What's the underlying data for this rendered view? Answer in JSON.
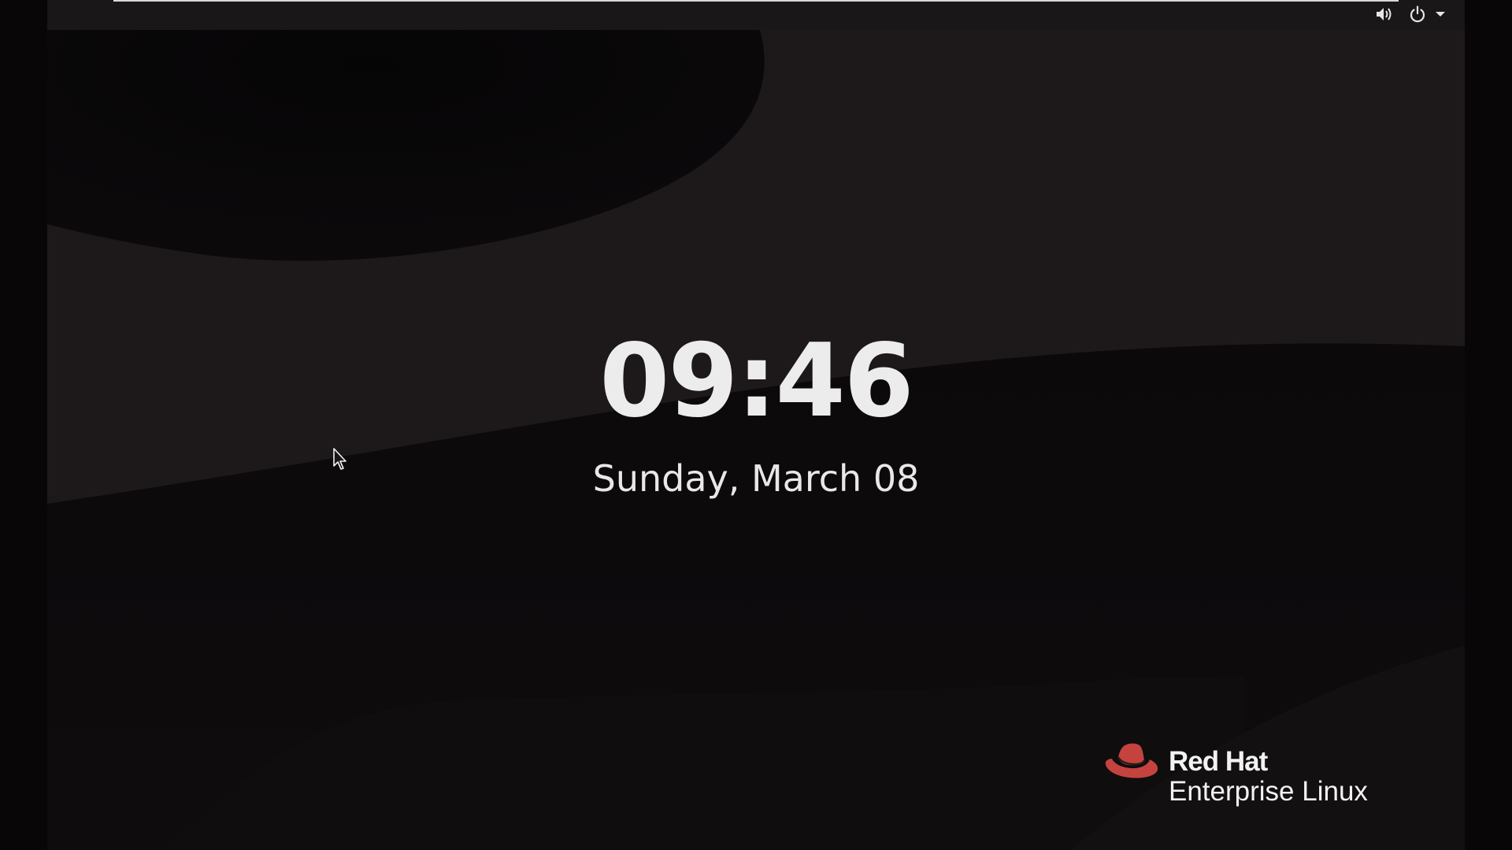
{
  "lock_screen": {
    "time": "09:46",
    "date": "Sunday, March 08"
  },
  "top_bar": {
    "icons": [
      "volume-icon",
      "power-icon",
      "menu-arrow-icon"
    ]
  },
  "branding": {
    "line1": "Red Hat",
    "line2": "Enterprise Linux",
    "logo_icon": "red-hat-logo",
    "logo_color": "#c4433f"
  },
  "colors": {
    "background": "#1d191b",
    "text": "#ececec",
    "accent": "#c4433f"
  }
}
